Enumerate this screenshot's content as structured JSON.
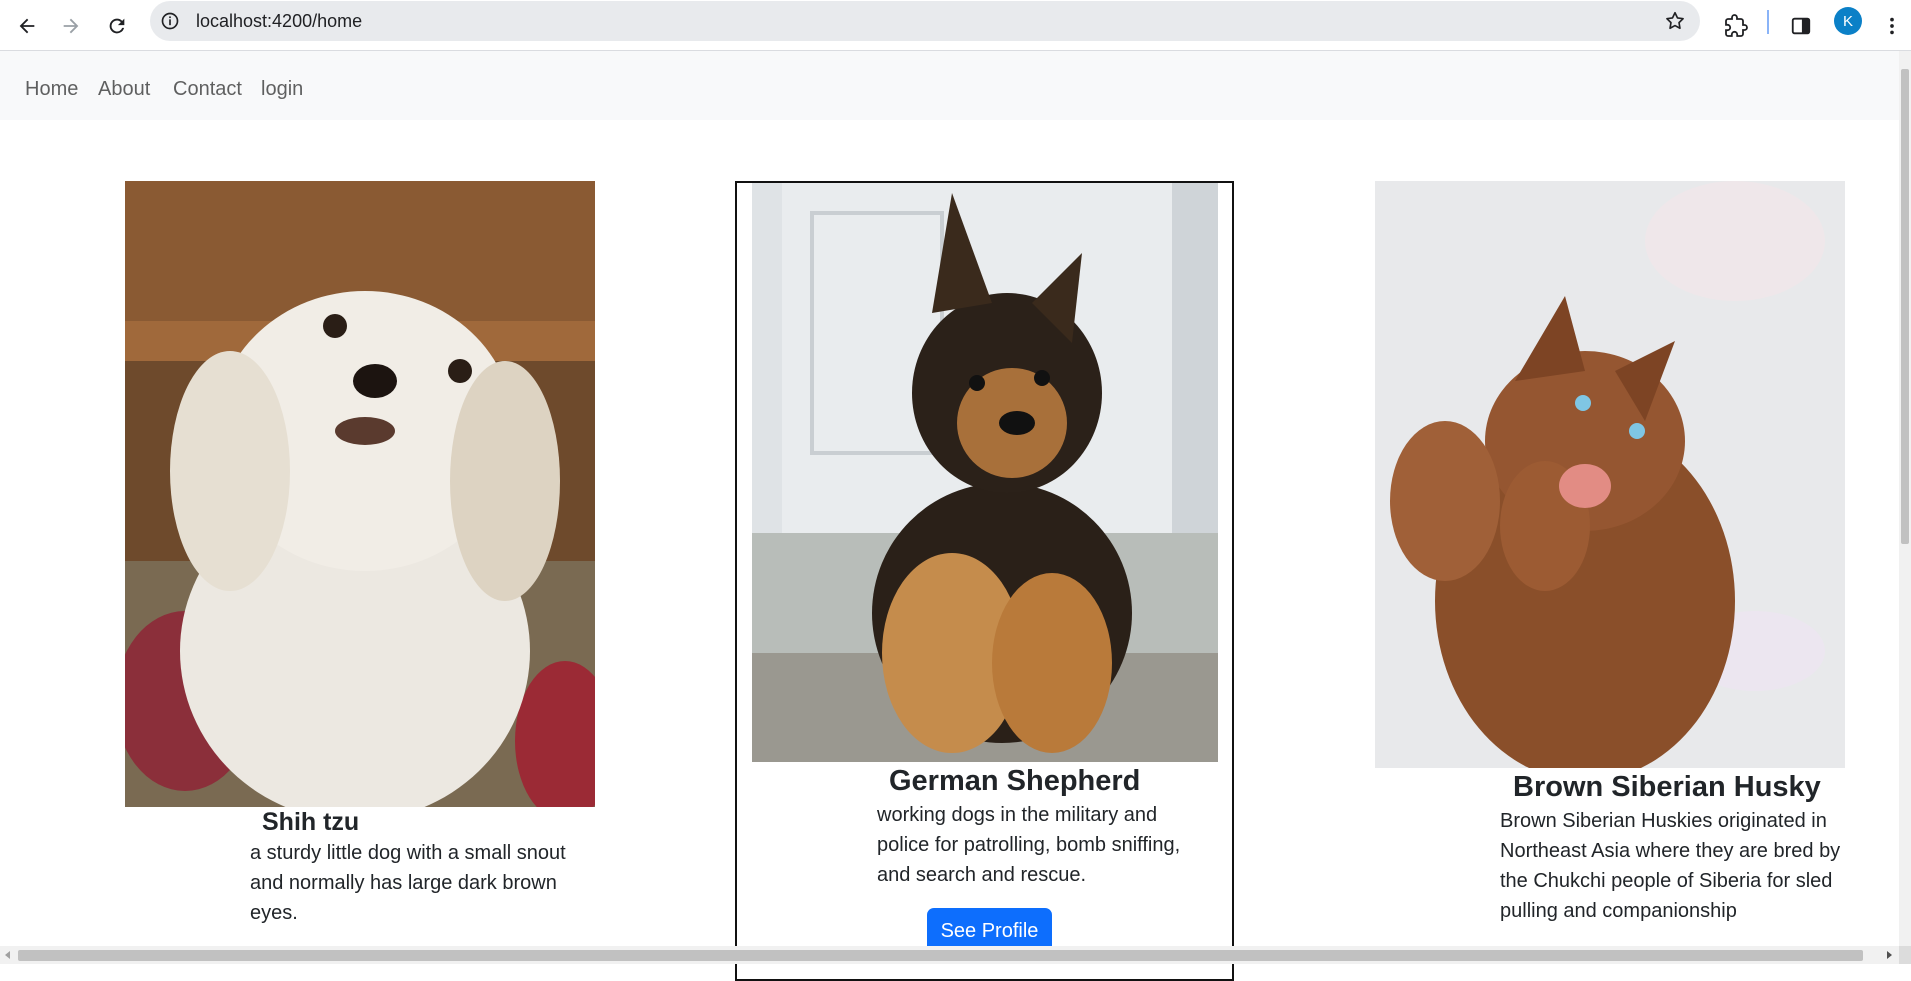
{
  "browser": {
    "url": "localhost:4200/home",
    "profile_initial": "K"
  },
  "nav": {
    "links": [
      "Home",
      "About",
      "Contact",
      "login"
    ]
  },
  "dogs": [
    {
      "name": "Shih tzu",
      "description": "a sturdy little dog with a small snout and normally has large dark brown eyes."
    },
    {
      "name": "German Shepherd",
      "description": "working dogs in the military and police for patrolling, bomb sniffing, and search and rescue.",
      "button_label": "See Profile"
    },
    {
      "name": "Brown Siberian Husky",
      "description": "Brown Siberian Huskies originated in Northeast Asia where they are bred by the Chukchi people of Siberia for sled pulling and companionship"
    }
  ],
  "colors": {
    "button": "#0d6efd",
    "navbar_bg": "#f8f9fa",
    "avatar": "#0b80c7"
  }
}
